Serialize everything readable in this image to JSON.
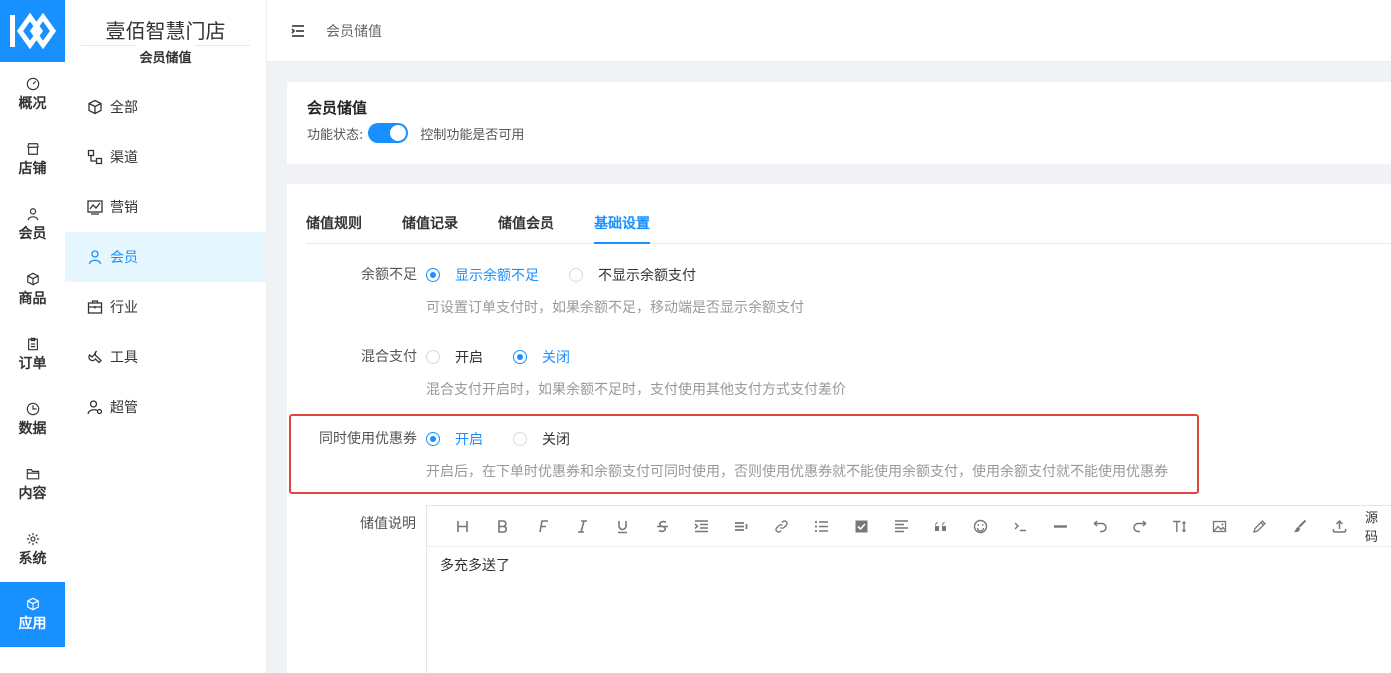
{
  "rail": {
    "items": [
      {
        "label": "概况",
        "icon": "dashboard-icon"
      },
      {
        "label": "店铺",
        "icon": "shop-icon"
      },
      {
        "label": "会员",
        "icon": "user-icon"
      },
      {
        "label": "商品",
        "icon": "cube-icon"
      },
      {
        "label": "订单",
        "icon": "clipboard-icon"
      },
      {
        "label": "数据",
        "icon": "pie-icon"
      },
      {
        "label": "内容",
        "icon": "folder-icon"
      },
      {
        "label": "系统",
        "icon": "gear-icon"
      },
      {
        "label": "应用",
        "icon": "cube-icon"
      }
    ]
  },
  "sidebar": {
    "store_name": "壹佰智慧门店",
    "section": "会员储值",
    "items": [
      {
        "label": "全部",
        "icon": "cube-icon"
      },
      {
        "label": "渠道",
        "icon": "channel-icon"
      },
      {
        "label": "营销",
        "icon": "chart-icon"
      },
      {
        "label": "会员",
        "icon": "user-icon"
      },
      {
        "label": "行业",
        "icon": "briefcase-icon"
      },
      {
        "label": "工具",
        "icon": "wrench-icon"
      },
      {
        "label": "超管",
        "icon": "admin-icon"
      }
    ]
  },
  "header": {
    "breadcrumb": "会员储值"
  },
  "feature": {
    "title": "会员储值",
    "status_label": "功能状态:",
    "status_on": true,
    "status_hint": "控制功能是否可用"
  },
  "tabs": [
    "储值规则",
    "储值记录",
    "储值会员",
    "基础设置"
  ],
  "settings": [
    {
      "label": "余额不足",
      "options": [
        "显示余额不足",
        "不显示余额支付"
      ],
      "hint": "可设置订单支付时，如果余额不足，移动端是否显示余额支付"
    },
    {
      "label": "混合支付",
      "options": [
        "开启",
        "关闭"
      ],
      "hint": "混合支付开启时，如果余额不足时，支付使用其他支付方式支付差价"
    },
    {
      "label": "同时使用优惠券",
      "options": [
        "开启",
        "关闭"
      ],
      "hint": "开启后，在下单时优惠券和余额支付可同时使用，否则使用优惠券就不能使用余额支付，使用余额支付就不能使用优惠券"
    }
  ],
  "description": {
    "label": "储值说明",
    "source_label": "源码",
    "content": "多充多送了"
  },
  "colors": {
    "primary": "#1890ff",
    "highlight": "#e0463a"
  }
}
